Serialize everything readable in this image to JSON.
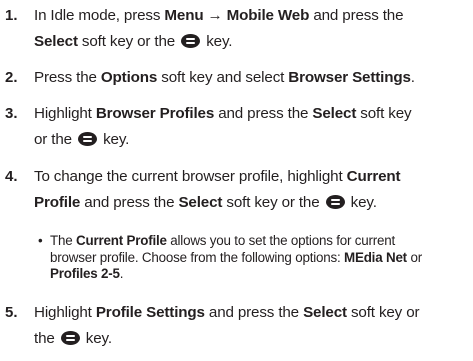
{
  "steps": [
    {
      "number": "1.",
      "parts": [
        "In Idle mode, press ",
        "Menu",
        " → ",
        "Mobile Web",
        " and press the",
        "Select",
        " soft key or the ",
        " key."
      ]
    },
    {
      "number": "2.",
      "parts": [
        "Press the ",
        "Options",
        " soft key and select ",
        "Browser Settings",
        "."
      ]
    },
    {
      "number": "3.",
      "parts": [
        "Highlight ",
        "Browser Profiles",
        " and press the ",
        "Select",
        " soft key",
        "or the ",
        " key."
      ]
    },
    {
      "number": "4.",
      "parts": [
        "To change the current browser profile, highlight ",
        "Current",
        "Profile",
        " and press the ",
        "Select",
        " soft key or the ",
        " key."
      ]
    },
    {
      "number": "5.",
      "parts": [
        "Highlight ",
        "Profile Settings",
        " and press the ",
        "Select",
        " soft key or",
        "the ",
        " key."
      ]
    }
  ],
  "bullet": {
    "marker": "•",
    "parts": [
      "The ",
      "Current Profile",
      " allows you to set the options for current",
      "browser profile. Choose from the following options: ",
      "MEdia Net",
      " or",
      "Profiles 2-5",
      "."
    ]
  },
  "icons": {
    "select_key": "ok-key-icon"
  }
}
